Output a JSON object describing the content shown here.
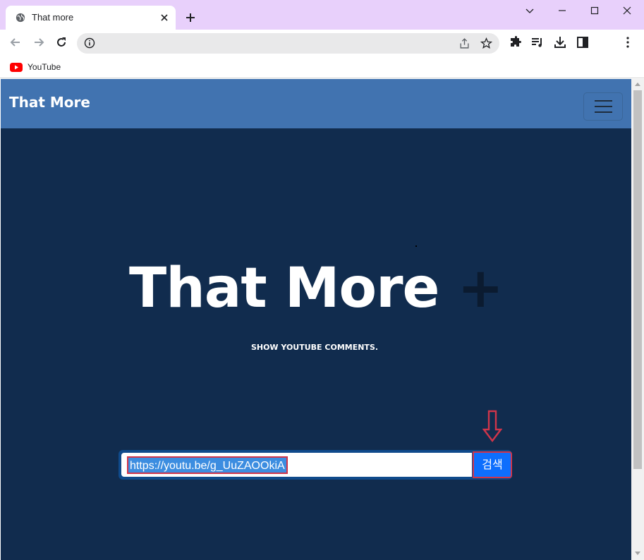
{
  "browser": {
    "tab_title": "That more",
    "bookmarks": [
      {
        "label": "YouTube",
        "icon": "youtube-icon"
      }
    ]
  },
  "page": {
    "brand": "That More",
    "hero": {
      "title": "That More",
      "title_accent": "+",
      "subtitle": "SHOW YOUTUBE COMMENTS."
    },
    "search": {
      "value": "https://youtu.be/g_UuZAOOkiA",
      "button_label": "검색"
    }
  },
  "colors": {
    "tabstrip": "#e8d0fb",
    "navbar": "#4173b0",
    "page_background": "#112c4e",
    "button": "#0d6efd",
    "annotation": "#d0354a"
  }
}
